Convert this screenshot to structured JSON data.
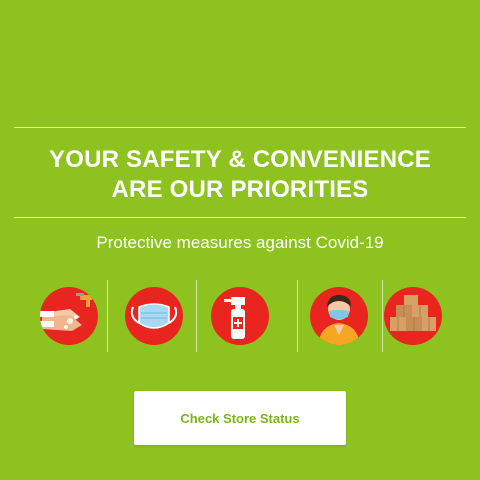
{
  "banner": {
    "headline_line1": "YOUR SAFETY & CONVENIENCE",
    "headline_line2": "ARE OUR PRIORITIES",
    "subheading": "Protective measures against Covid-19",
    "background_color": "#8dc21f",
    "accent_color": "#e8251f"
  },
  "measures": [
    {
      "icon": "hand-washing-icon"
    },
    {
      "icon": "face-mask-icon"
    },
    {
      "icon": "sanitizer-spray-icon"
    },
    {
      "icon": "masked-staff-icon"
    },
    {
      "icon": "packages-icon"
    }
  ],
  "cta": {
    "label": "Check Store Status",
    "text_color": "#7bb51a"
  }
}
